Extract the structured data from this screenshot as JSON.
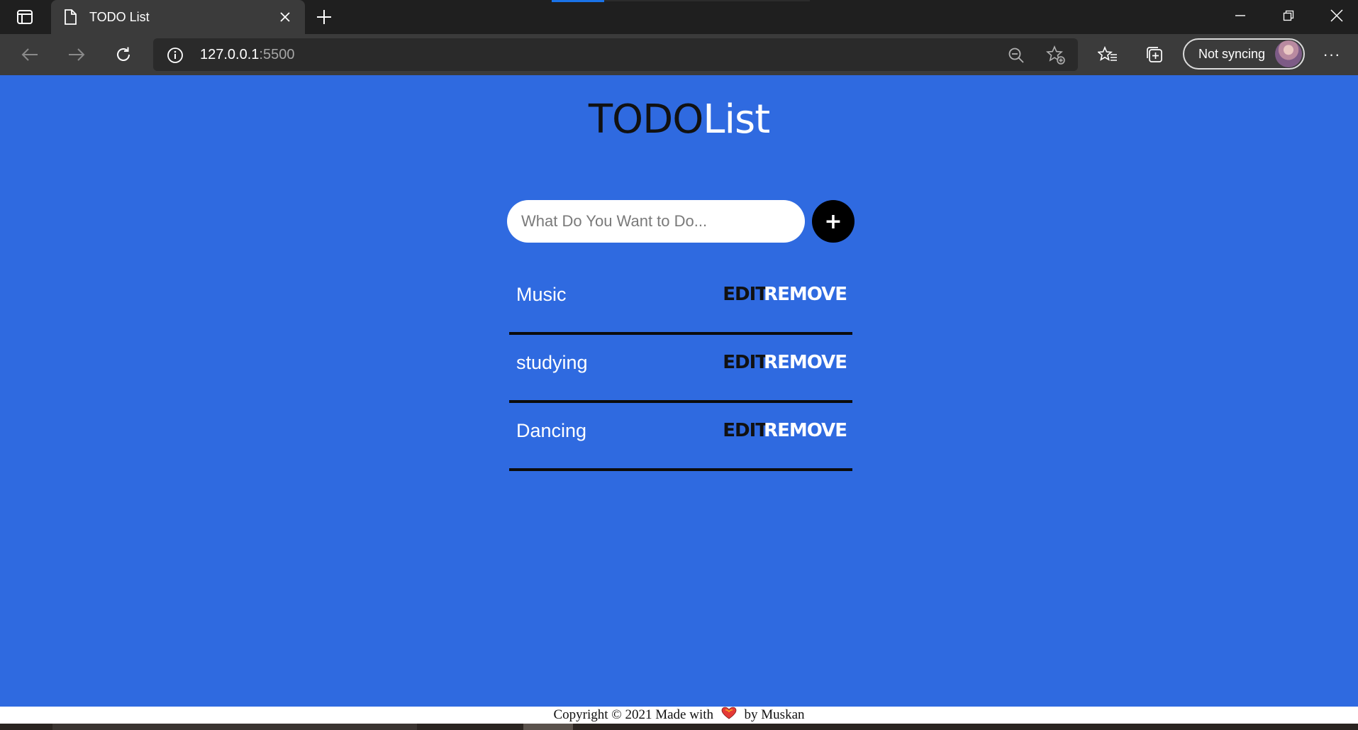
{
  "browser": {
    "tab_title": "TODO List",
    "url_host": "127.0.0.1",
    "url_port": ":5500",
    "profile_label": "Not syncing",
    "more_label": "···"
  },
  "page": {
    "heading_part1": "TODO",
    "heading_part2": "List",
    "input_placeholder": "What Do You Want to Do...",
    "add_button_label": "+",
    "todos": [
      {
        "task": "Music",
        "edit": "EDIT",
        "remove": "REMOVE"
      },
      {
        "task": "studying",
        "edit": "EDIT",
        "remove": "REMOVE"
      },
      {
        "task": "Dancing",
        "edit": "EDIT",
        "remove": "REMOVE"
      }
    ],
    "footer_before": "Copyright © 2021 Made with",
    "footer_after": "by Muskan"
  },
  "colors": {
    "page_background": "#2f6ae0",
    "heading_dark": "#111111",
    "heading_light": "#ffffff",
    "remove_text": "#ffffff",
    "edit_text": "#111111",
    "heart": "#e53935"
  }
}
